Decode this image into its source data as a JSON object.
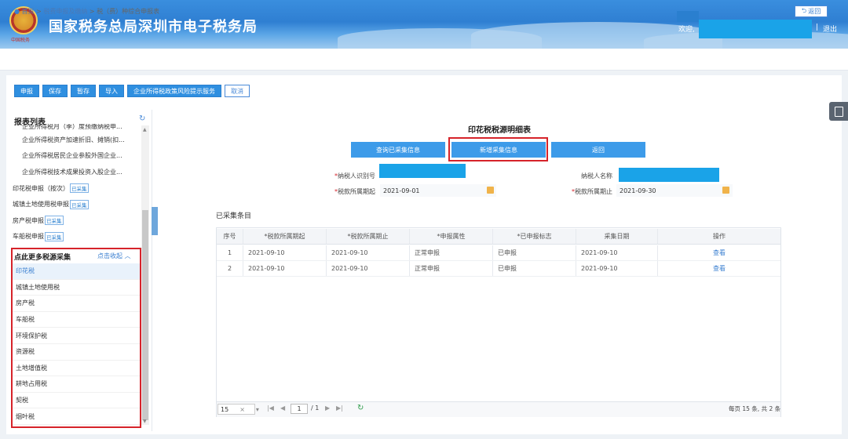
{
  "header": {
    "title": "国家税务总局深圳市电子税务局",
    "emblem_caption": "中国税务",
    "welcome": "欢迎,",
    "separator": "|",
    "logout": "退出",
    "brand_color": "#2f7fd2"
  },
  "breadcrumb": {
    "items": [
      "首页",
      "税费申报及缴纳",
      "税（费）种综合申报表"
    ],
    "separator": ">",
    "back_label": "返回"
  },
  "toolbar": {
    "buttons": [
      "申报",
      "保存",
      "暂存",
      "导入",
      "企业所得税政策风险提示服务"
    ],
    "cancel_label": "取消"
  },
  "sidebar": {
    "title": "报表列表",
    "items": [
      {
        "label": "企业所得税月（季）度预缴纳税申...",
        "tag": ""
      },
      {
        "label": "企业所得税资产加速折旧、摊销(扣...",
        "tag": ""
      },
      {
        "label": "企业所得税居民企业参股外国企业...",
        "tag": ""
      },
      {
        "label": "企业所得税技术成果投资入股企业...",
        "tag": ""
      },
      {
        "label": "印花税申报（按次）",
        "tag": "已采集"
      },
      {
        "label": "城镇土地使用税申报",
        "tag": "已采集"
      },
      {
        "label": "房产税申报",
        "tag": "已采集"
      },
      {
        "label": "车船税申报",
        "tag": "已采集"
      }
    ],
    "more": {
      "title": "点此更多税源采集",
      "fold_label": "点击收起",
      "items": [
        "印花税",
        "城镇土地使用税",
        "房产税",
        "车船税",
        "环境保护税",
        "资源税",
        "土地增值税",
        "耕地占用税",
        "契税",
        "烟叶税"
      ],
      "active_index": 0
    }
  },
  "form": {
    "title": "印花税税源明细表",
    "buttons": {
      "query": "查询已采集信息",
      "add": "新增采集信息",
      "back": "返回"
    },
    "taxpayer_id_label": "纳税人识别号",
    "taxpayer_name_label": "纳税人名称",
    "period_start_label": "税款所属期起",
    "period_start": "2021-09-01",
    "period_end_label": "税款所属期止",
    "period_end": "2021-09-30",
    "required_mark": "*",
    "highlight_color": "#d6232a"
  },
  "table": {
    "section_title": "已采集条目",
    "columns": [
      "序号",
      "*税款所属期起",
      "*税款所属期止",
      "*申报属性",
      "*已申报标志",
      "采集日期",
      "操作"
    ],
    "rows": [
      {
        "no": "1",
        "start": "2021-09-10",
        "end": "2021-09-10",
        "attr": "正常申报",
        "flag": "已申报",
        "date": "2021-09-10",
        "op": "查看"
      },
      {
        "no": "2",
        "start": "2021-09-10",
        "end": "2021-09-10",
        "attr": "正常申报",
        "flag": "已申报",
        "date": "2021-09-10",
        "op": "查看"
      }
    ]
  },
  "pager": {
    "page_size": "15",
    "current_page": "1",
    "total_pages_label": "/ 1",
    "info": "每页 15 条, 共 2 条"
  }
}
